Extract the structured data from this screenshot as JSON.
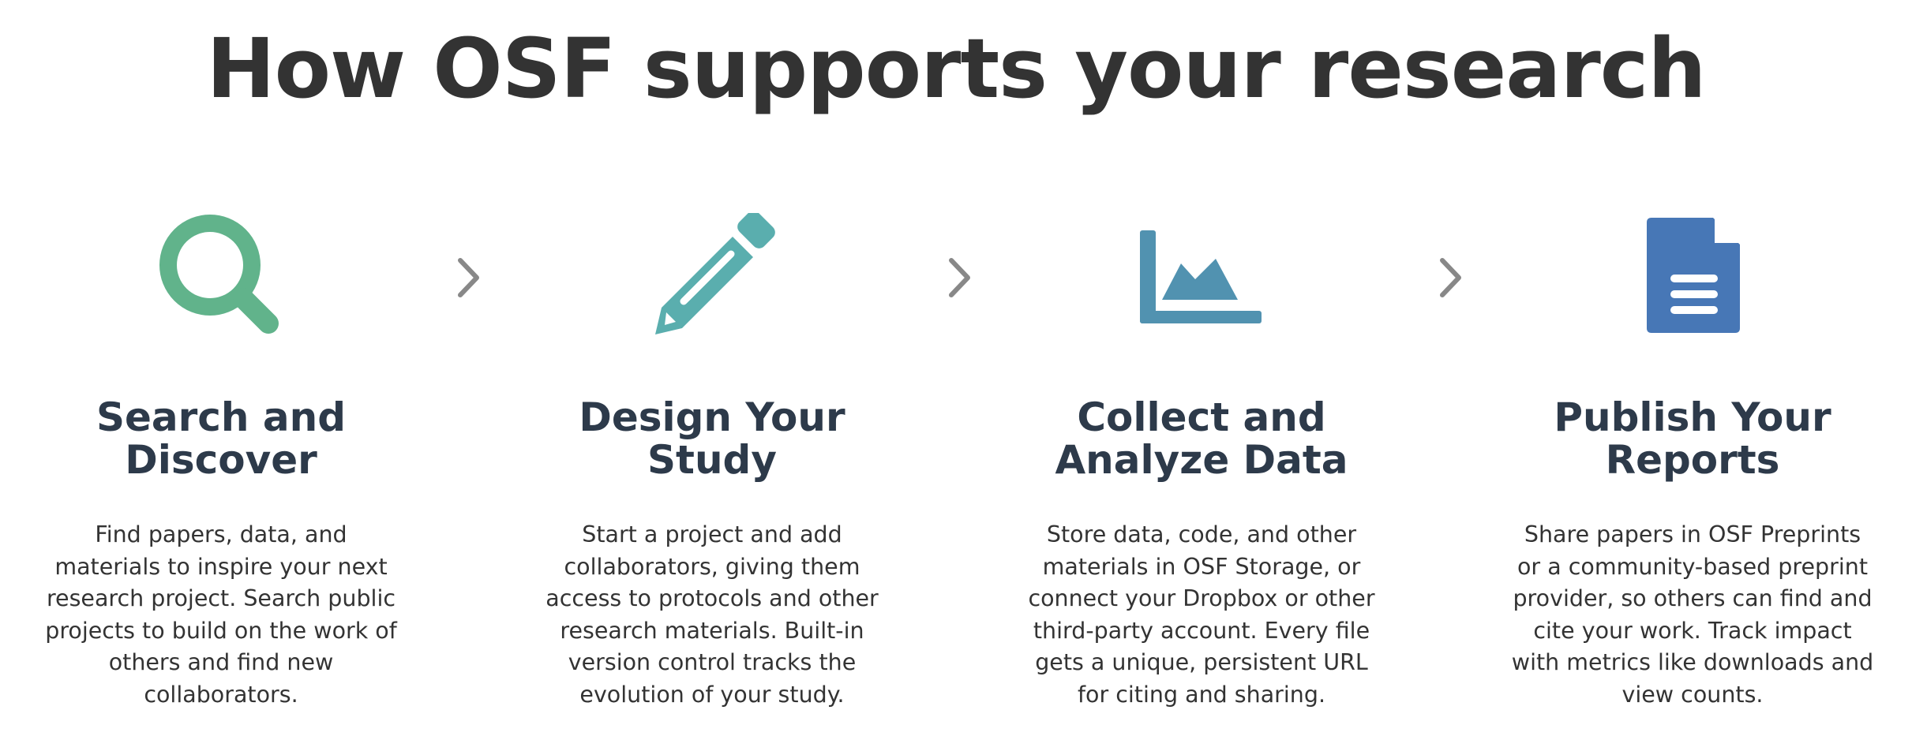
{
  "page": {
    "title": "How OSF supports your research"
  },
  "steps": [
    {
      "icon": "search-icon",
      "icon_color": "#61b38b",
      "title_line1": "Search and",
      "title_line2": "Discover",
      "description": "Find papers, data, and materials to inspire your next research project. Search public projects to build on the work of others and find new collaborators."
    },
    {
      "icon": "pencil-icon",
      "icon_color": "#5aaeae",
      "title_line1": "Design Your",
      "title_line2": "Study",
      "description": "Start a project and add collaborators, giving them access to protocols and other research materials. Built-in version control tracks the evolution of your study."
    },
    {
      "icon": "area-chart-icon",
      "icon_color": "#5192b0",
      "title_line1": "Collect and",
      "title_line2": "Analyze Data",
      "description": "Store data, code, and other materials in OSF Storage, or connect your Dropbox or other third-party account. Every file gets a unique, persistent URL for citing and sharing."
    },
    {
      "icon": "document-icon",
      "icon_color": "#4777b6",
      "title_line1": "Publish Your",
      "title_line2": "Reports",
      "description": "Share papers in OSF Preprints or a community-based preprint provider, so others can find and cite your work. Track impact with metrics like downloads and view counts."
    }
  ],
  "chevron_color": "#888888",
  "heading_color": "#2d3a4a"
}
